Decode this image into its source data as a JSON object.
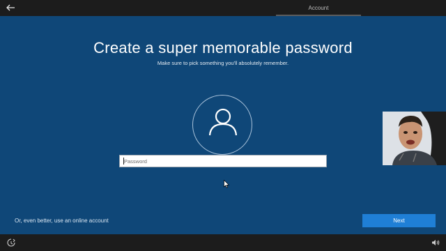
{
  "topbar": {
    "back_icon": "arrow-left-icon",
    "active_tab": "Account"
  },
  "main": {
    "title": "Create a super memorable password",
    "subtitle": "Make sure to pick something you'll absolutely remember.",
    "avatar_icon": "user-icon",
    "password": {
      "placeholder": "Password",
      "value": ""
    },
    "online_account_link": "Or, even better, use an online account",
    "next_label": "Next"
  },
  "bottombar": {
    "ease_of_access_icon": "ease-of-access-icon",
    "volume_icon": "volume-icon"
  },
  "colors": {
    "background": "#0f4778",
    "accent": "#1f7fd6",
    "bar": "#1c1c1c"
  },
  "overlay": {
    "webcam": "person-on-webcam"
  }
}
